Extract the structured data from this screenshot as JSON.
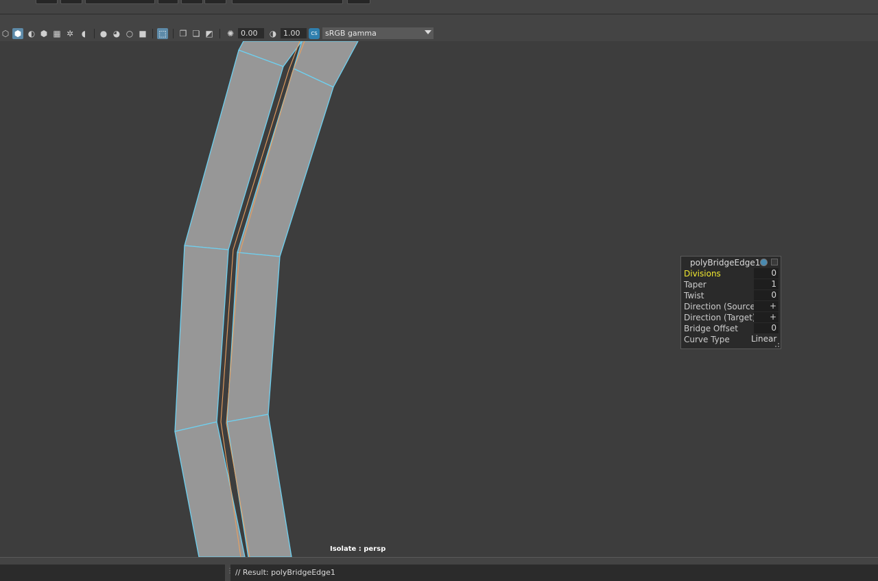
{
  "toolbar": {
    "exposure_value": "0.00",
    "gamma_value": "1.00",
    "colorspace": "sRGB gamma",
    "colorspace_icon": "CS"
  },
  "viewport": {
    "isolate_label": "Isolate : persp"
  },
  "hud": {
    "title": "polyBridgeEdge1",
    "rows": [
      {
        "label": "Divisions",
        "value": "0"
      },
      {
        "label": "Taper",
        "value": "1"
      },
      {
        "label": "Twist",
        "value": "0"
      },
      {
        "label": "Direction (Source)",
        "value": "+"
      },
      {
        "label": "Direction (Target)",
        "value": "+"
      },
      {
        "label": "Bridge Offset",
        "value": "0"
      },
      {
        "label": "Curve Type",
        "value": "Linear"
      }
    ]
  },
  "status": {
    "result_text": "// Result: polyBridgeEdge1"
  },
  "colors": {
    "background": "#3d3d3d",
    "mesh_face": "#979797",
    "edge_highlight": "#6ed0f0",
    "seam_line": "#e8a060",
    "selected_attribute": "#f2ea30"
  }
}
